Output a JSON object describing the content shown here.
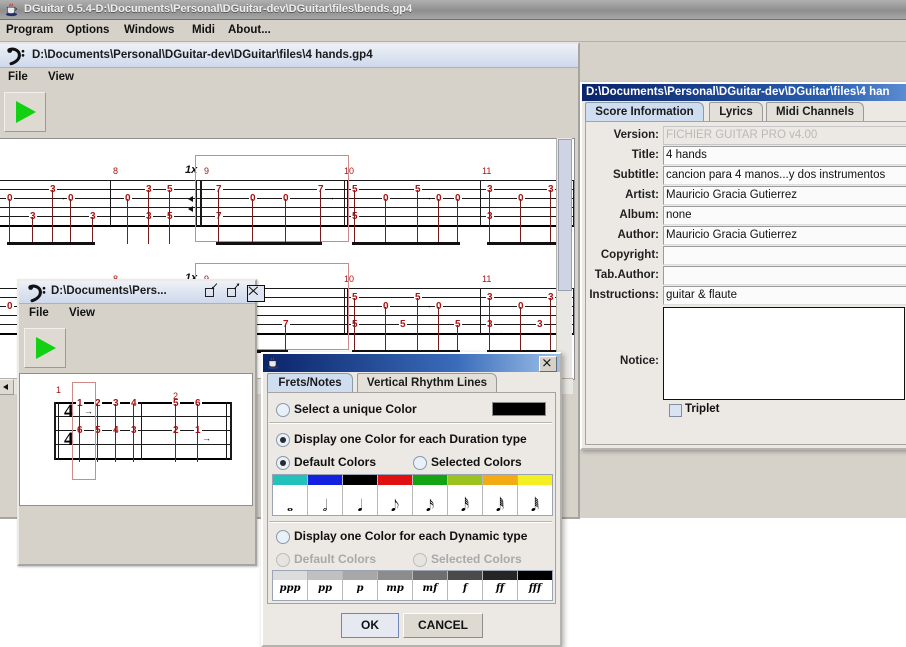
{
  "app": {
    "title": "DGuitar 0.5.4-D:\\Documents\\Personal\\DGuitar-dev\\DGuitar\\files\\bends.gp4",
    "icon": "java-cup-icon",
    "menu": [
      "Program",
      "Options",
      "Windows",
      "Midi",
      "About..."
    ]
  },
  "doc_window": {
    "title": "D:\\Documents\\Personal\\DGuitar-dev\\DGuitar\\files\\4 hands.gp4",
    "menu": [
      "File",
      "View"
    ],
    "play_button": "play-icon",
    "measure_numbers": [
      "8",
      "9",
      "10",
      "11"
    ],
    "repeat_label": "1x"
  },
  "doc_window2": {
    "title": "D:\\Documents\\Pers...",
    "menu": [
      "File",
      "View"
    ],
    "play_button": "play-icon",
    "buttons": [
      "minimize",
      "maximize",
      "close"
    ],
    "measure_numbers": [
      "1",
      "2"
    ],
    "time_signature": [
      "4",
      "4"
    ],
    "frets_top": [
      "1",
      "2",
      "3",
      "4",
      "5",
      "6"
    ],
    "frets_bottom": [
      "6",
      "5",
      "4",
      "3",
      "2",
      "1"
    ]
  },
  "score_dialog": {
    "title": "D:\\Documents\\Personal\\DGuitar-dev\\DGuitar\\files\\4 han",
    "tabs": [
      {
        "label": "Score Information",
        "selected": true
      },
      {
        "label": "Lyrics",
        "selected": false
      },
      {
        "label": "Midi Channels",
        "selected": false
      }
    ],
    "fields": [
      {
        "label": "Version:",
        "value": "FICHIER GUITAR PRO v4.00",
        "disabled": true
      },
      {
        "label": "Title:",
        "value": "4 hands",
        "disabled": false
      },
      {
        "label": "Subtitle:",
        "value": "cancion para 4 manos...y dos instrumentos",
        "disabled": false
      },
      {
        "label": "Artist:",
        "value": "Mauricio Gracia Gutierrez",
        "disabled": false
      },
      {
        "label": "Album:",
        "value": "none",
        "disabled": false
      },
      {
        "label": "Author:",
        "value": "Mauricio Gracia Gutierrez",
        "disabled": false
      },
      {
        "label": "Copyright:",
        "value": "",
        "disabled": false
      },
      {
        "label": "Tab.Author:",
        "value": "",
        "disabled": false
      },
      {
        "label": "Instructions:",
        "value": "guitar & flaute",
        "disabled": false
      }
    ],
    "notice_label": "Notice:",
    "notice_value": "",
    "triplet_label": "Triplet",
    "triplet_checked": false
  },
  "color_dialog": {
    "title": "",
    "icon": "java-cup-icon",
    "close_icon": "close-icon",
    "tabs": [
      {
        "label": "Frets/Notes",
        "selected": true
      },
      {
        "label": "Vertical Rhythm Lines",
        "selected": false
      }
    ],
    "unique_color_label": "Select a unique Color",
    "unique_color_selected": false,
    "unique_color_value": "#000000",
    "duration_label": "Display one Color for each Duration type",
    "duration_selected": true,
    "duration_default_label": "Default Colors",
    "duration_default_selected": true,
    "duration_selected_label": "Selected Colors",
    "duration_selected_selected": false,
    "duration_colors": [
      "#22c1bb",
      "#1420e0",
      "#000000",
      "#e01010",
      "#13a313",
      "#9cc21f",
      "#f3aa14",
      "#f4ef23"
    ],
    "duration_glyphs": [
      "𝅝",
      "𝅗𝅥",
      "𝅘𝅥",
      "𝅘𝅥𝅮",
      "𝅘𝅥𝅯",
      "𝅘𝅥𝅰",
      "𝅘𝅥𝅱",
      "𝅘𝅥𝅲"
    ],
    "dynamic_label": "Display one Color for each Dynamic type",
    "dynamic_selected": false,
    "dynamic_default_label": "Default Colors",
    "dynamic_default_selected": false,
    "dynamic_selected_label": "Selected Colors",
    "dynamic_selected_selected": false,
    "dynamic_colors": [
      "#dcdcdc",
      "#c0c0c0",
      "#a8a8a8",
      "#8c8c8c",
      "#6e6e6e",
      "#4a4a4a",
      "#252525",
      "#000000"
    ],
    "dynamic_glyphs": [
      "ppp",
      "pp",
      "p",
      "mp",
      "mf",
      "f",
      "ff",
      "fff"
    ],
    "ok_label": "OK",
    "cancel_label": "CANCEL"
  }
}
